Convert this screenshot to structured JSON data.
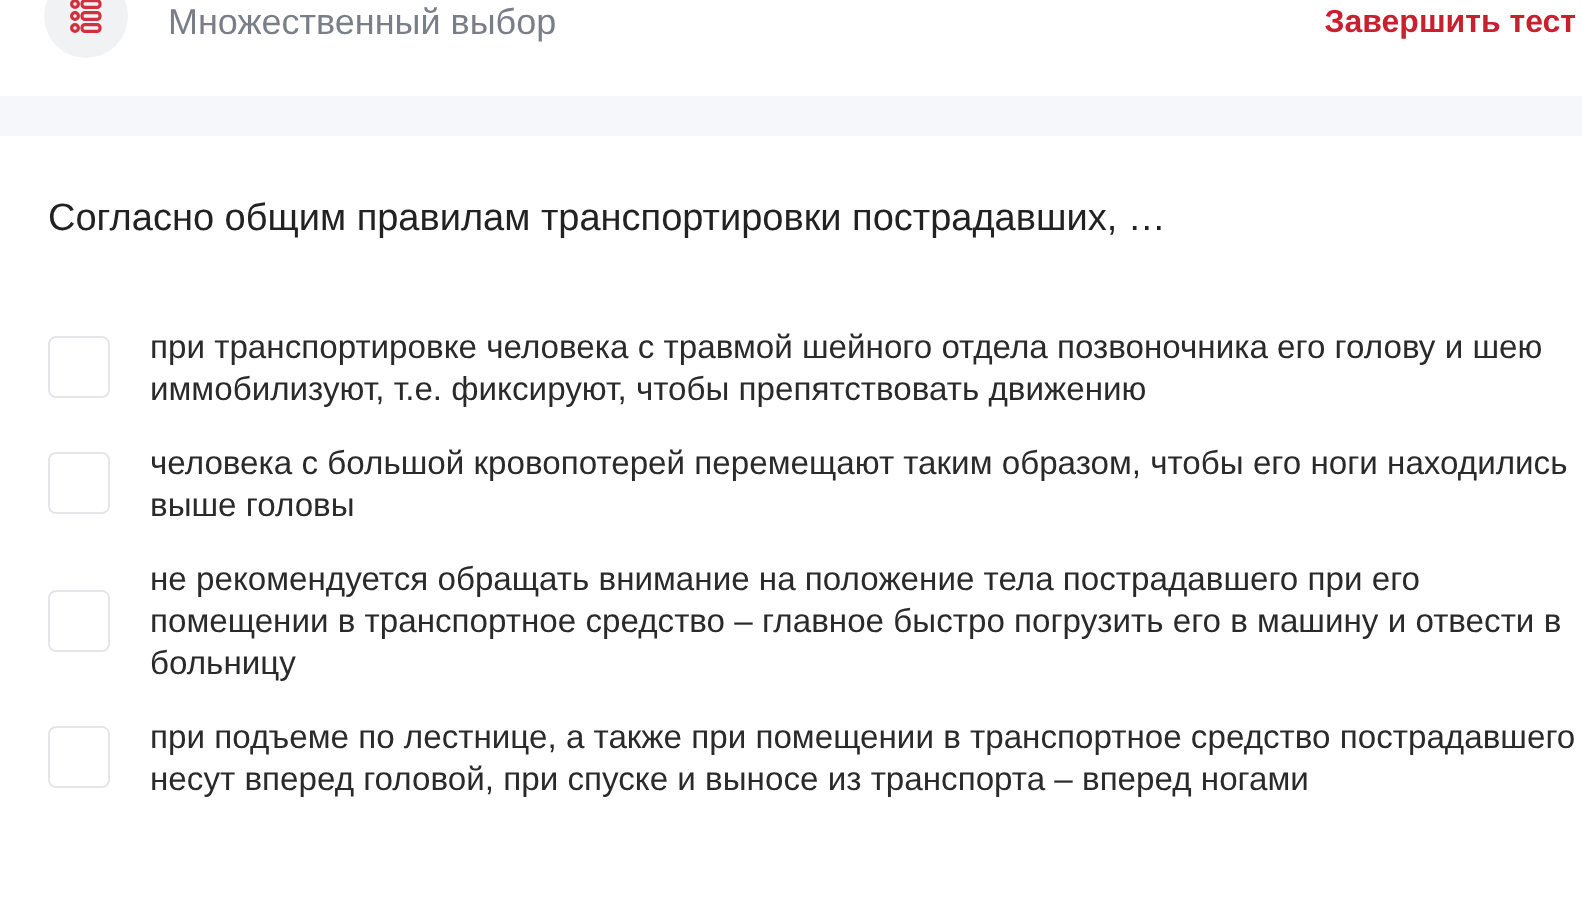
{
  "header": {
    "title": "Множественный выбор",
    "finish_button": "Завершить тест"
  },
  "question": "Согласно общим правилам транспортировки пострадавших, …",
  "options": [
    {
      "text": "при транспортировке человека с травмой шейного отдела позвоночника его голову и шею иммобилизуют, т.е. фиксируют, чтобы препятствовать движению",
      "checked": false
    },
    {
      "text": "человека с большой кровопотерей перемещают таким образом, чтобы его ноги находились выше головы",
      "checked": false
    },
    {
      "text": "не рекомендуется обращать внимание на положение тела пострадавшего при его помещении в транспортное средство – главное быстро погрузить его в машину и отвести в больницу",
      "checked": false
    },
    {
      "text": "при подъеме по лестнице, а также при помещении в транспортное средство пострадавшего несут вперед головой, при спуске и выносе из транспорта – вперед ногами",
      "checked": false
    }
  ]
}
